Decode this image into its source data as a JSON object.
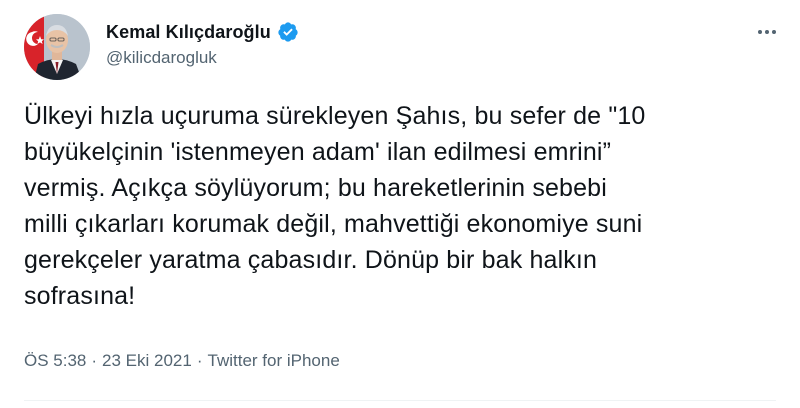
{
  "author": {
    "name": "Kemal Kılıçdaroğlu",
    "handle": "@kilicdarogluk",
    "verified_icon": "verified-badge-icon",
    "verified_color": "#1d9bf0"
  },
  "tweet": {
    "text": "Ülkeyi hızla uçuruma sürekleyen Şahıs, bu sefer de \"10\nbüyükelçinin 'istenmeyen adam' ilan edilmesi emrini”\nvermiş. Açıkça söylüyorum; bu hareketlerinin sebebi\nmilli çıkarları korumak değil, mahvettiği ekonomiye suni\ngerekçeler yaratma çabasıdır. Dönüp bir bak halkın\nsofrasına!"
  },
  "meta": {
    "time": "ÖS 5:38",
    "separator": "·",
    "date": "23 Eki 2021",
    "source": "Twitter for iPhone"
  },
  "colors": {
    "text": "#0f1419",
    "secondary": "#536471",
    "divider": "#eff3f4"
  }
}
